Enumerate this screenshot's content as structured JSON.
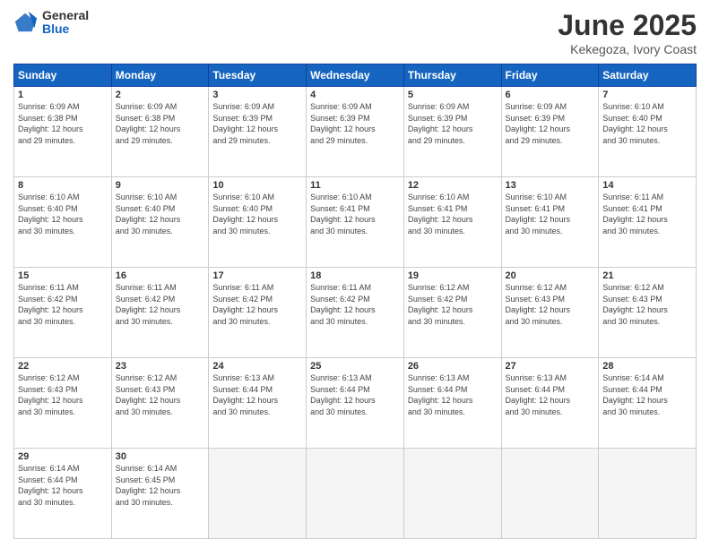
{
  "logo": {
    "general": "General",
    "blue": "Blue"
  },
  "title": "June 2025",
  "subtitle": "Kekegoza, Ivory Coast",
  "headers": [
    "Sunday",
    "Monday",
    "Tuesday",
    "Wednesday",
    "Thursday",
    "Friday",
    "Saturday"
  ],
  "weeks": [
    [
      {
        "day": "1",
        "sunrise": "6:09 AM",
        "sunset": "6:38 PM",
        "daylight": "12 hours and 29 minutes."
      },
      {
        "day": "2",
        "sunrise": "6:09 AM",
        "sunset": "6:38 PM",
        "daylight": "12 hours and 29 minutes."
      },
      {
        "day": "3",
        "sunrise": "6:09 AM",
        "sunset": "6:39 PM",
        "daylight": "12 hours and 29 minutes."
      },
      {
        "day": "4",
        "sunrise": "6:09 AM",
        "sunset": "6:39 PM",
        "daylight": "12 hours and 29 minutes."
      },
      {
        "day": "5",
        "sunrise": "6:09 AM",
        "sunset": "6:39 PM",
        "daylight": "12 hours and 29 minutes."
      },
      {
        "day": "6",
        "sunrise": "6:09 AM",
        "sunset": "6:39 PM",
        "daylight": "12 hours and 29 minutes."
      },
      {
        "day": "7",
        "sunrise": "6:10 AM",
        "sunset": "6:40 PM",
        "daylight": "12 hours and 30 minutes."
      }
    ],
    [
      {
        "day": "8",
        "sunrise": "6:10 AM",
        "sunset": "6:40 PM",
        "daylight": "12 hours and 30 minutes."
      },
      {
        "day": "9",
        "sunrise": "6:10 AM",
        "sunset": "6:40 PM",
        "daylight": "12 hours and 30 minutes."
      },
      {
        "day": "10",
        "sunrise": "6:10 AM",
        "sunset": "6:40 PM",
        "daylight": "12 hours and 30 minutes."
      },
      {
        "day": "11",
        "sunrise": "6:10 AM",
        "sunset": "6:41 PM",
        "daylight": "12 hours and 30 minutes."
      },
      {
        "day": "12",
        "sunrise": "6:10 AM",
        "sunset": "6:41 PM",
        "daylight": "12 hours and 30 minutes."
      },
      {
        "day": "13",
        "sunrise": "6:10 AM",
        "sunset": "6:41 PM",
        "daylight": "12 hours and 30 minutes."
      },
      {
        "day": "14",
        "sunrise": "6:11 AM",
        "sunset": "6:41 PM",
        "daylight": "12 hours and 30 minutes."
      }
    ],
    [
      {
        "day": "15",
        "sunrise": "6:11 AM",
        "sunset": "6:42 PM",
        "daylight": "12 hours and 30 minutes."
      },
      {
        "day": "16",
        "sunrise": "6:11 AM",
        "sunset": "6:42 PM",
        "daylight": "12 hours and 30 minutes."
      },
      {
        "day": "17",
        "sunrise": "6:11 AM",
        "sunset": "6:42 PM",
        "daylight": "12 hours and 30 minutes."
      },
      {
        "day": "18",
        "sunrise": "6:11 AM",
        "sunset": "6:42 PM",
        "daylight": "12 hours and 30 minutes."
      },
      {
        "day": "19",
        "sunrise": "6:12 AM",
        "sunset": "6:42 PM",
        "daylight": "12 hours and 30 minutes."
      },
      {
        "day": "20",
        "sunrise": "6:12 AM",
        "sunset": "6:43 PM",
        "daylight": "12 hours and 30 minutes."
      },
      {
        "day": "21",
        "sunrise": "6:12 AM",
        "sunset": "6:43 PM",
        "daylight": "12 hours and 30 minutes."
      }
    ],
    [
      {
        "day": "22",
        "sunrise": "6:12 AM",
        "sunset": "6:43 PM",
        "daylight": "12 hours and 30 minutes."
      },
      {
        "day": "23",
        "sunrise": "6:12 AM",
        "sunset": "6:43 PM",
        "daylight": "12 hours and 30 minutes."
      },
      {
        "day": "24",
        "sunrise": "6:13 AM",
        "sunset": "6:44 PM",
        "daylight": "12 hours and 30 minutes."
      },
      {
        "day": "25",
        "sunrise": "6:13 AM",
        "sunset": "6:44 PM",
        "daylight": "12 hours and 30 minutes."
      },
      {
        "day": "26",
        "sunrise": "6:13 AM",
        "sunset": "6:44 PM",
        "daylight": "12 hours and 30 minutes."
      },
      {
        "day": "27",
        "sunrise": "6:13 AM",
        "sunset": "6:44 PM",
        "daylight": "12 hours and 30 minutes."
      },
      {
        "day": "28",
        "sunrise": "6:14 AM",
        "sunset": "6:44 PM",
        "daylight": "12 hours and 30 minutes."
      }
    ],
    [
      {
        "day": "29",
        "sunrise": "6:14 AM",
        "sunset": "6:44 PM",
        "daylight": "12 hours and 30 minutes."
      },
      {
        "day": "30",
        "sunrise": "6:14 AM",
        "sunset": "6:45 PM",
        "daylight": "12 hours and 30 minutes."
      },
      null,
      null,
      null,
      null,
      null
    ]
  ],
  "labels": {
    "sunrise": "Sunrise: ",
    "sunset": "Sunset: ",
    "daylight": "Daylight: "
  }
}
